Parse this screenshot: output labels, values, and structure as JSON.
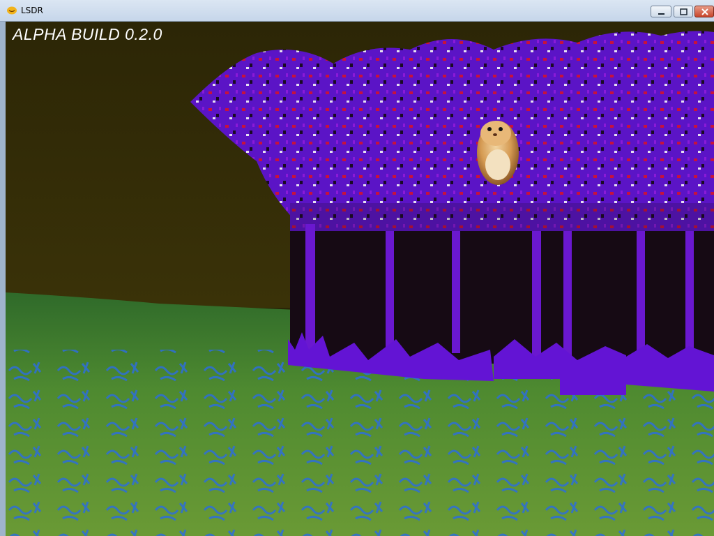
{
  "window": {
    "title": "LSDR",
    "controls": [
      "minimize-button",
      "maximize-button",
      "close-button"
    ]
  },
  "hud": {
    "build_label": "ALPHA BUILD 0.2.0"
  },
  "scene": {
    "sky_color": "#2a2506",
    "ground_color": "#3f7a2a",
    "ground_glyph_color": "#2f6fd0",
    "foliage_color": "#5a12c8",
    "foliage_accent": "#d0103a",
    "creature": "hamster-character"
  }
}
